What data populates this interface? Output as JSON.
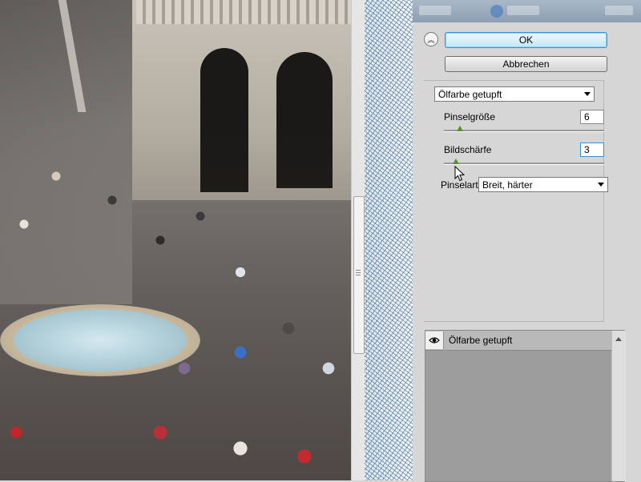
{
  "dialog": {
    "ok_label": "OK",
    "cancel_label": "Abbrechen",
    "collapse_icon": "double-chevron-up-icon"
  },
  "filter": {
    "selected": "Ölfarbe getupft",
    "params": {
      "brush_size": {
        "label": "Pinselgröße",
        "value": "6",
        "level": 0.15
      },
      "sharpness": {
        "label": "Bildschärfe",
        "value": "3",
        "level": 0.09
      },
      "brush_type": {
        "label": "Pinselart:",
        "selected": "Breit, härter"
      }
    }
  },
  "layers": {
    "items": [
      {
        "name": "Ölfarbe getupft",
        "visible": true
      }
    ]
  },
  "colors": {
    "ok_border": "#3a8fd9",
    "panel_bg": "#d6d6d6",
    "slider_thumb": "#5a8f2f"
  }
}
